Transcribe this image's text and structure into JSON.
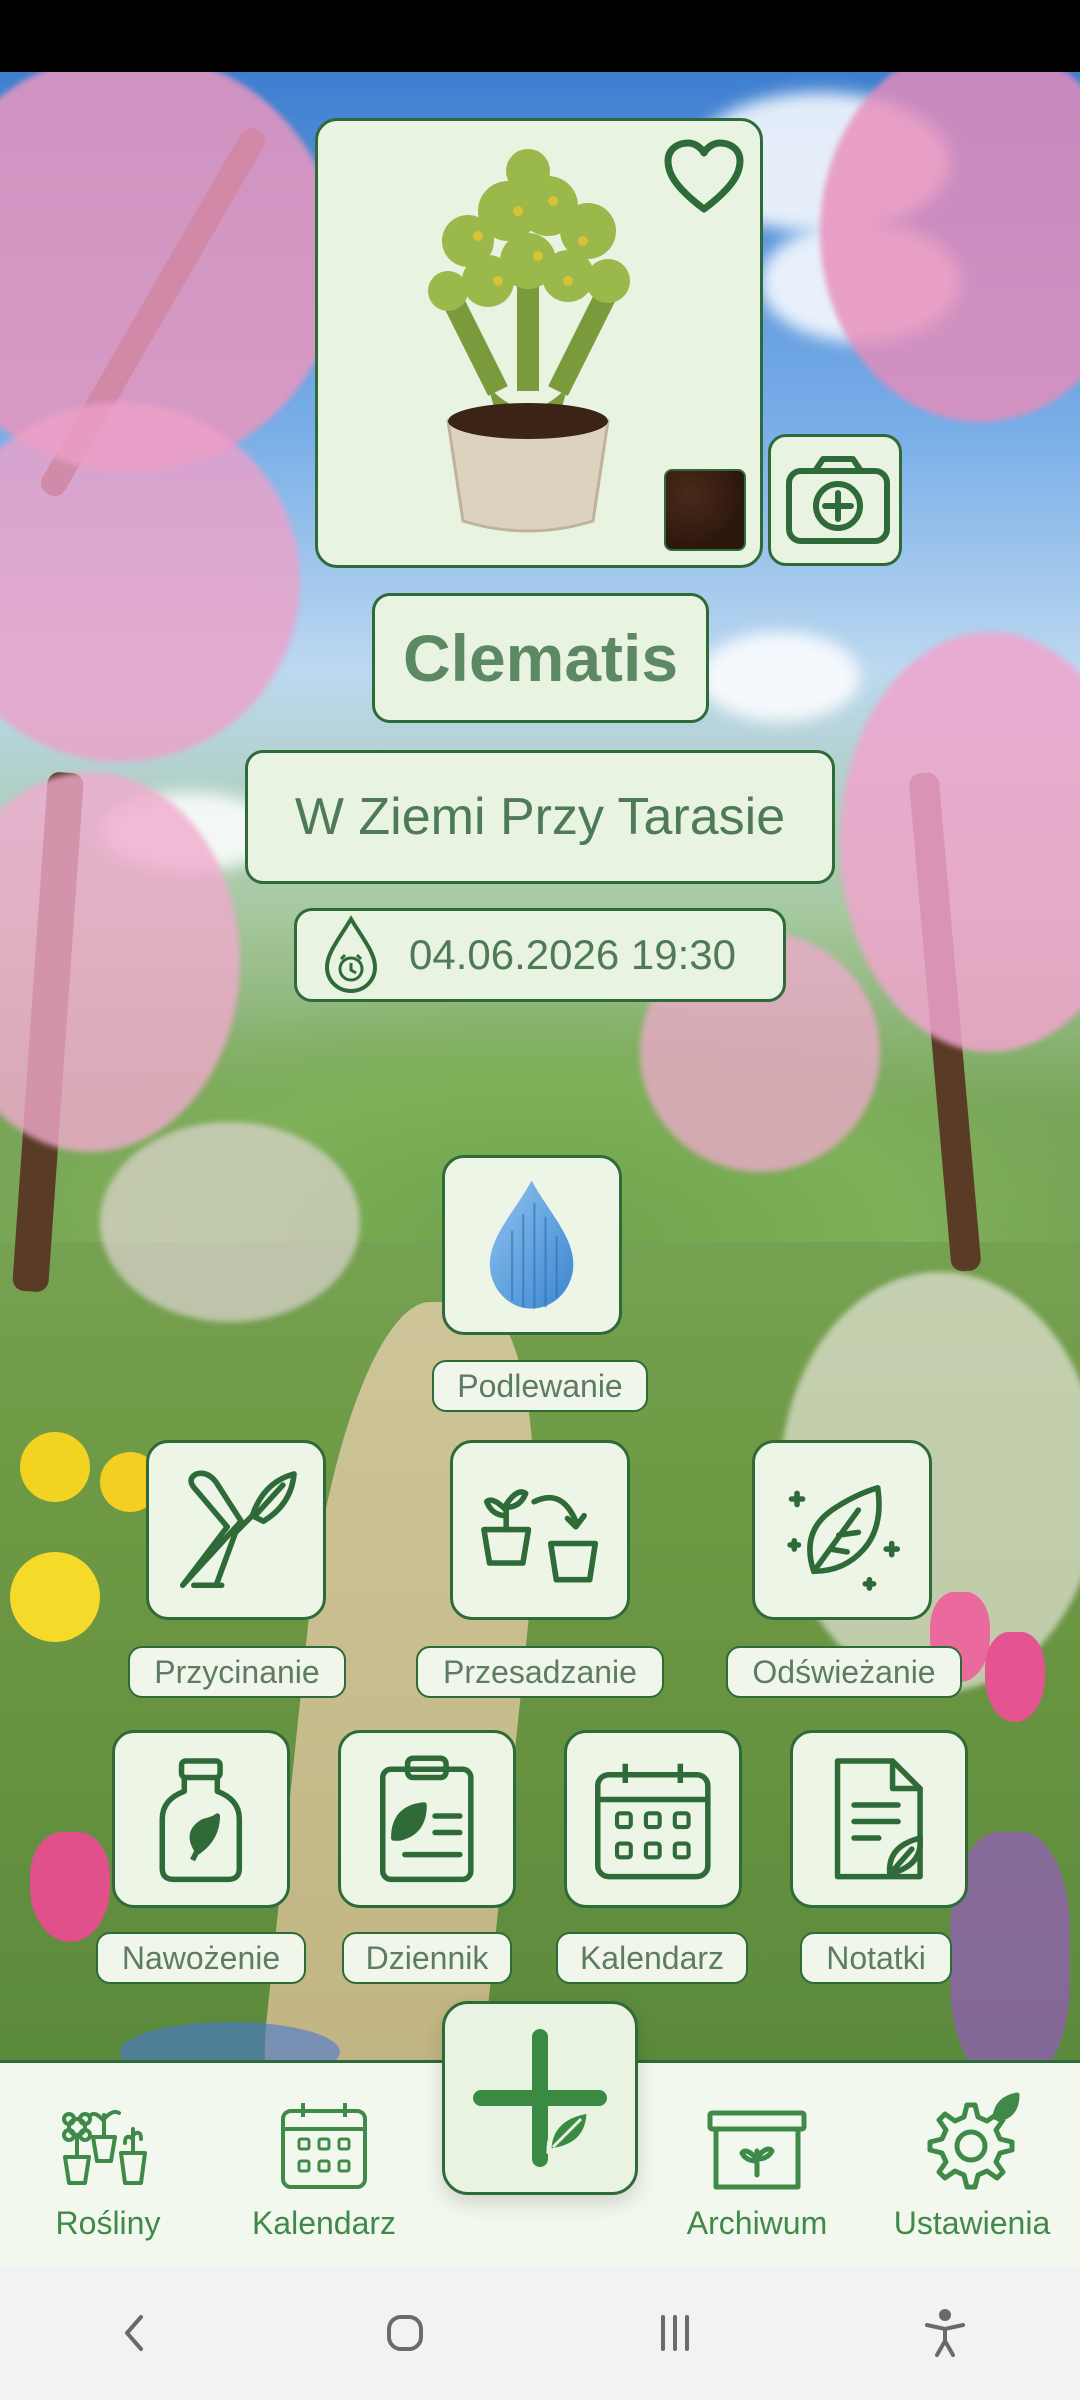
{
  "plant": {
    "name": "Clematis",
    "location": "W Ziemi Przy Tarasie",
    "next_watering": "04.06.2026 19:30",
    "favorite": true
  },
  "actions": {
    "watering": "Podlewanie",
    "pruning": "Przycinanie",
    "repotting": "Przesadzanie",
    "refreshing": "Odświeżanie",
    "fertilizing": "Nawożenie",
    "journal": "Dziennik",
    "calendar": "Kalendarz",
    "notes": "Notatki"
  },
  "nav": {
    "plants": "Rośliny",
    "calendar": "Kalendarz",
    "archive": "Archiwum",
    "settings": "Ustawienia"
  },
  "colors": {
    "accent": "#2f6b38",
    "panel": "#e9f3e1",
    "text": "#4f7a57"
  }
}
